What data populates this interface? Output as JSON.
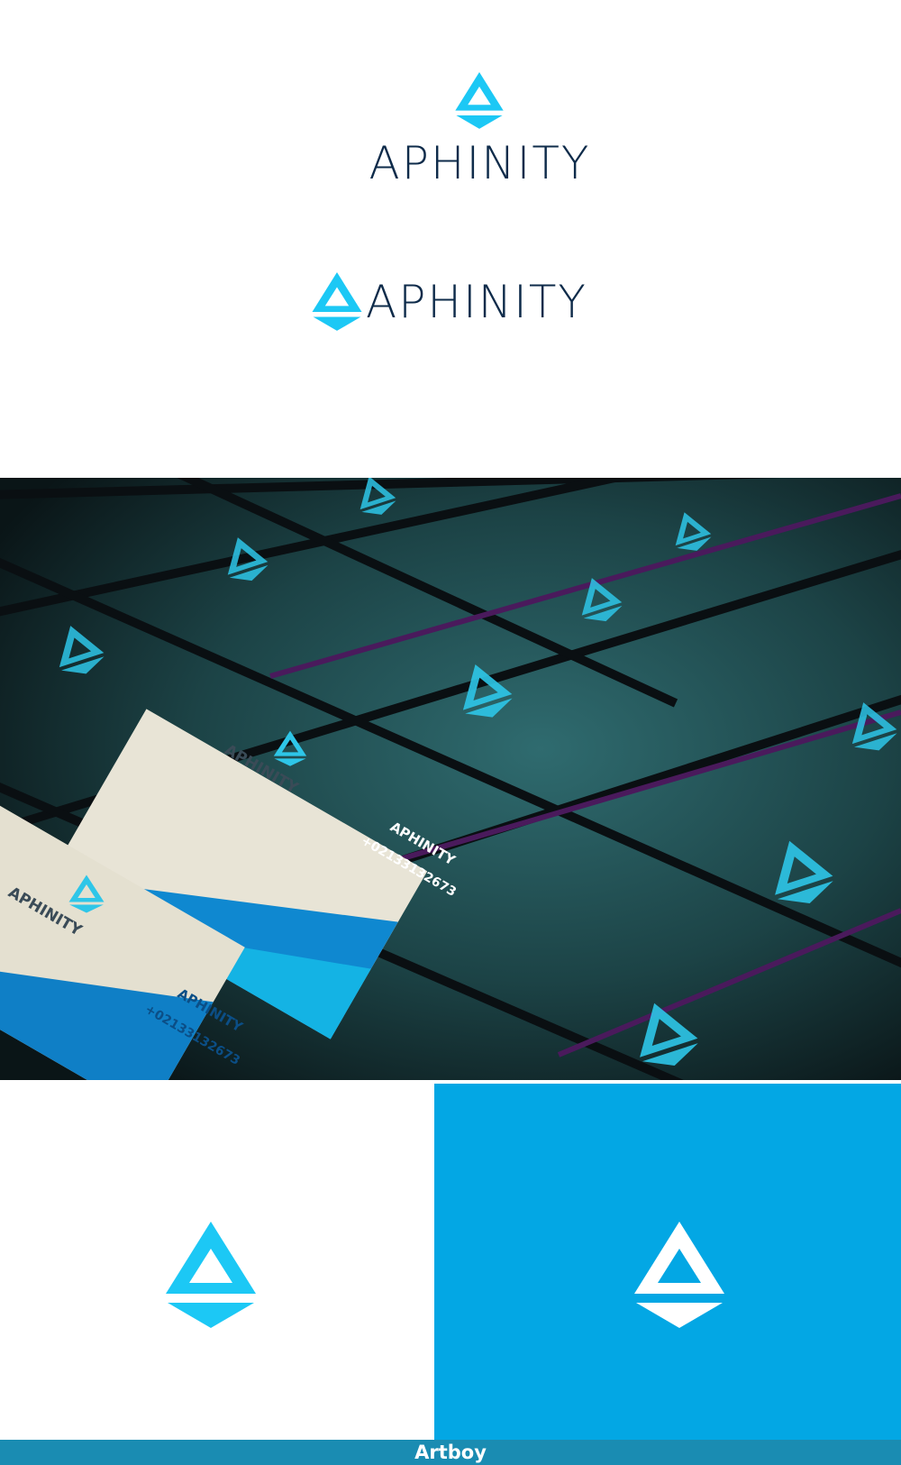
{
  "brand": {
    "name": "APHINITY",
    "accent": "#1cc8f5",
    "dark": "#0e2b4a",
    "blue": "#03a7e4"
  },
  "card": {
    "brand": "APHINITY",
    "phone": "+02133132673"
  },
  "footer": {
    "label": "Artboy"
  }
}
